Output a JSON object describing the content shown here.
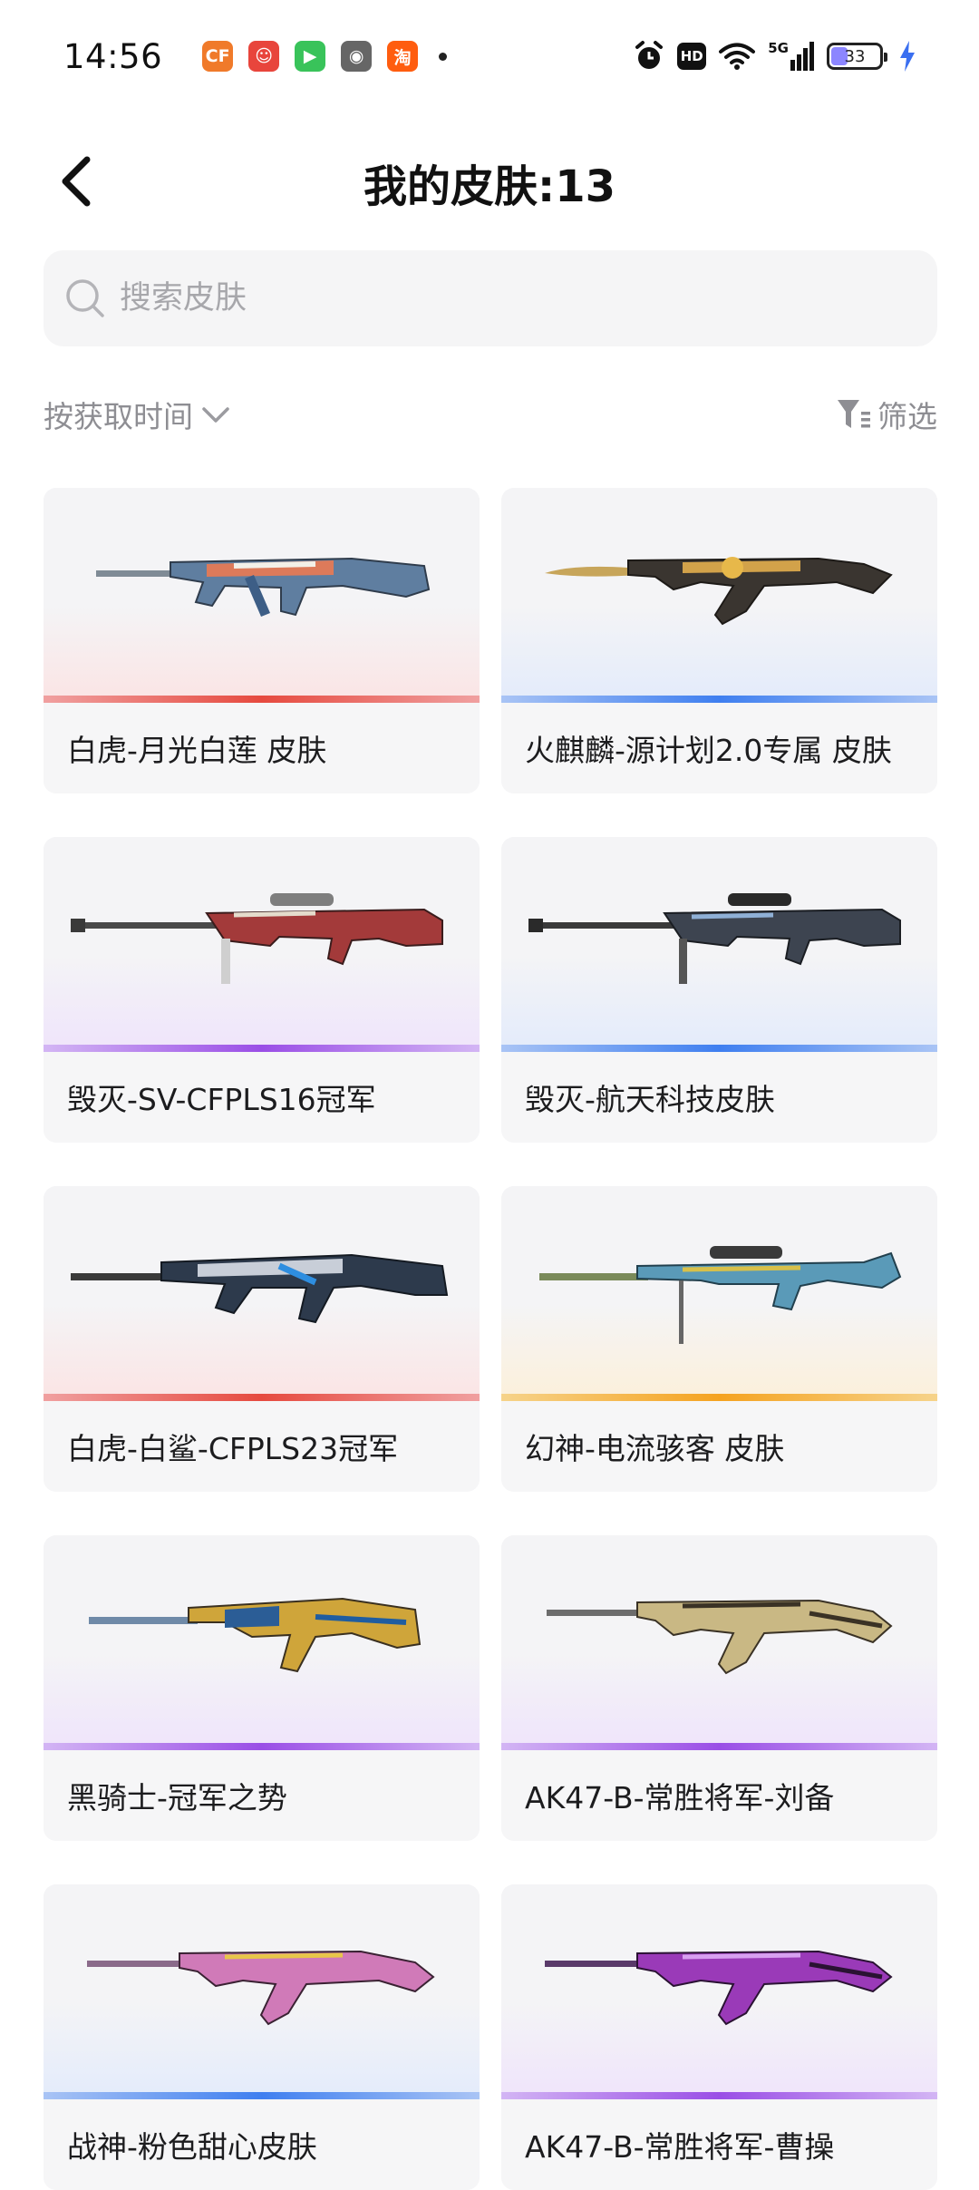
{
  "status_bar": {
    "time": "14:56",
    "apps": [
      {
        "icon": "cf-game-icon",
        "glyph": "CF",
        "color": "#f07a2a"
      },
      {
        "icon": "clown-app-icon",
        "glyph": "☺",
        "color": "#e8453c"
      },
      {
        "icon": "video-app-icon",
        "glyph": "▶",
        "color": "#39c35a"
      },
      {
        "icon": "avatar-app-icon",
        "glyph": "◉",
        "color": "#666666"
      },
      {
        "icon": "taobao-icon",
        "glyph": "淘",
        "color": "#ff5d0f"
      }
    ],
    "network": "5G",
    "hd": "HD",
    "battery": "33",
    "battery_level": 0.33
  },
  "header": {
    "title": "我的皮肤:13"
  },
  "search": {
    "placeholder": "搜索皮肤",
    "value": ""
  },
  "toolbar": {
    "sort_label": "按获取时间",
    "filter_label": "筛选"
  },
  "skins": [
    {
      "name": "白虎-月光白莲 皮肤",
      "rarity": "red"
    },
    {
      "name": "火麒麟-源计划2.0专属 皮肤",
      "rarity": "blue"
    },
    {
      "name": "毁灭-SV-CFPLS16冠军",
      "rarity": "purple"
    },
    {
      "name": "毁灭-航天科技皮肤",
      "rarity": "blue"
    },
    {
      "name": "白虎-白鲨-CFPLS23冠军",
      "rarity": "red"
    },
    {
      "name": "幻神-电流骇客 皮肤",
      "rarity": "orange"
    },
    {
      "name": "黑骑士-冠军之势",
      "rarity": "purple"
    },
    {
      "name": "AK47-B-常胜将军-刘备",
      "rarity": "purple"
    },
    {
      "name": "战神-粉色甜心皮肤",
      "rarity": "blue"
    },
    {
      "name": "AK47-B-常胜将军-曹操",
      "rarity": "purple"
    }
  ],
  "colors": {
    "accent_text": "#1c1c1e",
    "muted_text": "#8e8e93",
    "card_bg": "#f5f5f7"
  }
}
